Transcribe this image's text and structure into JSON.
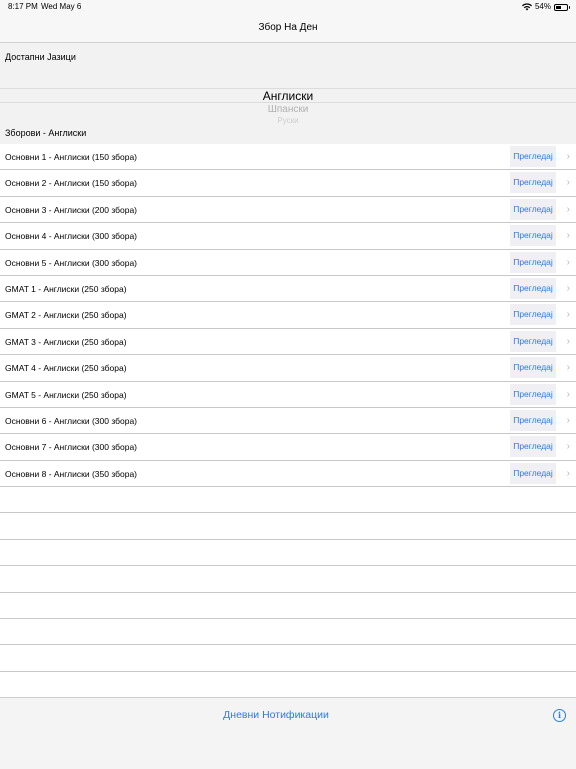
{
  "status": {
    "time": "8:17 PM",
    "date": "Wed May 6",
    "battery": "54%",
    "battery_level": 0.54
  },
  "nav": {
    "title": "Збор На Ден"
  },
  "languages": {
    "header": "Достапни Јазици",
    "options": [
      "Англиски",
      "Шпански",
      "Руски"
    ],
    "selected": "Англиски"
  },
  "sets": {
    "header": "Зборови - Англиски",
    "preview_label": "Прегледај",
    "items": [
      "Основни 1 - Англиски (150 збора)",
      "Основни 2 - Англиски (150 збора)",
      "Основни 3 - Англиски (200 збора)",
      "Основни 4 - Англиски (300 збора)",
      "Основни 5 - Англиски (300 збора)",
      "GMAT 1 - Англиски (250 збора)",
      "GMAT 2 - Англиски (250 збора)",
      "GMAT 3 - Англиски (250 збора)",
      "GMAT 4 - Англиски (250 збора)",
      "GMAT 5 - Англиски (250 збора)",
      "Основни 6 - Англиски (300 збора)",
      "Основни 7 - Англиски (300 збора)",
      "Основни 8 - Англиски (350 збора)"
    ]
  },
  "footer": {
    "notifications_label": "Дневни Нотификации",
    "info_icon": "info-icon"
  },
  "colors": {
    "accent": "#2b7de0",
    "gray_bg": "#f2f2f2"
  }
}
